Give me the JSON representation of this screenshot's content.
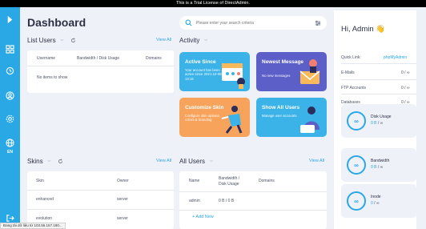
{
  "banner": "This is a Trial License of DirectAdmin.",
  "sidebar": {
    "language": "EN"
  },
  "page_title": "Dashboard",
  "search": {
    "placeholder": "Please enter your search criteria"
  },
  "list_users": {
    "title": "List Users",
    "view_all": "View All",
    "columns": [
      "Username",
      "Bandwidth / Disk Usage",
      "Domains"
    ],
    "empty_text": "No items to show"
  },
  "activity": {
    "title": "Activity",
    "tiles": [
      {
        "title": "Active Since",
        "desc": "Your account has been active since 2021-10-08 13:16",
        "color": "#3bb3e8"
      },
      {
        "title": "Newest Message",
        "desc": "No new messages",
        "color": "#5b5fc7"
      },
      {
        "title": "Customize Skin",
        "desc": "Configure skin options, colors & branding",
        "color": "#f7a35c"
      },
      {
        "title": "Show All Users",
        "desc": "Manage user accounts",
        "color": "#3bb3e8"
      }
    ]
  },
  "skins": {
    "title": "Skins",
    "view_all": "View All",
    "columns": [
      "Skin",
      "Owner"
    ],
    "rows": [
      {
        "skin": "enhanced",
        "owner": "server"
      },
      {
        "skin": "evolution",
        "owner": "server"
      }
    ]
  },
  "all_users": {
    "title": "All Users",
    "view_all": "View All",
    "columns": [
      "Name",
      "Bandwidth / Disk Usage",
      "Domains"
    ],
    "rows": [
      {
        "name": "admin",
        "usage": "0 B / 0 B",
        "domains": ""
      }
    ],
    "add_new": "+ Add New"
  },
  "right_panel": {
    "greeting": "Hi, Admin 👋",
    "quick_link_label": "Quick Link:",
    "quick_link": "phpMyAdmin",
    "stats": [
      {
        "label": "E-Mails",
        "value": "0 / ∞"
      },
      {
        "label": "FTP Accounts",
        "value": "0 / ∞"
      },
      {
        "label": "Databases",
        "value": "0 / ∞"
      }
    ],
    "usage": [
      {
        "title": "Disk Usage",
        "used": "0 B",
        "limit": "/ ∞"
      },
      {
        "title": "Bandwidth",
        "used": "0 B",
        "limit": "/ ∞"
      },
      {
        "title": "Inode",
        "used": "0",
        "limit": "/ ∞"
      }
    ]
  },
  "status_bar": "Đang tải dữ liệu từ 103.56.157.180..."
}
